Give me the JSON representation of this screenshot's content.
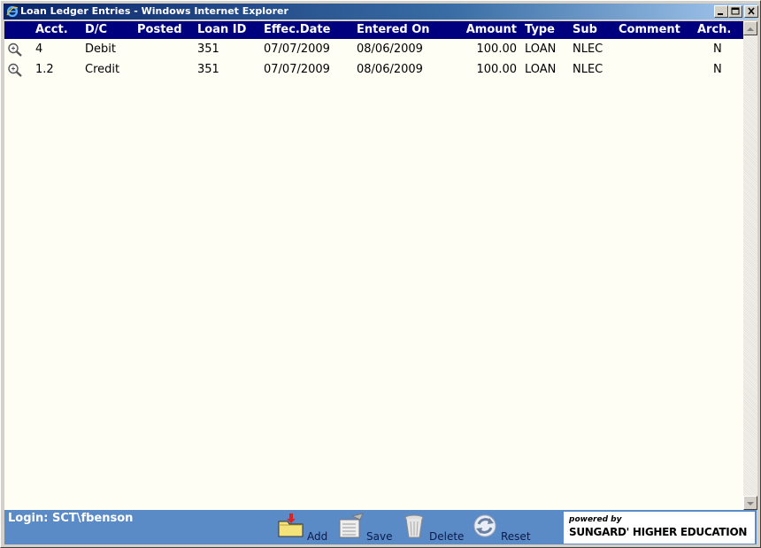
{
  "window": {
    "title": "Loan Ledger Entries - Windows Internet Explorer"
  },
  "grid": {
    "columns": [
      "Acct.",
      "D/C",
      "Posted",
      "Loan ID",
      "Effec.Date",
      "Entered On",
      "Amount",
      "Type",
      "Sub",
      "Comment",
      "Arch."
    ],
    "rows": [
      {
        "acct": "4",
        "dc": "Debit",
        "posted": "",
        "loan_id": "351",
        "effec_date": "07/07/2009",
        "entered_on": "08/06/2009",
        "amount": "100.00",
        "type": "LOAN",
        "sub": "NLEC",
        "comment": "",
        "arch": "N"
      },
      {
        "acct": "1.2",
        "dc": "Credit",
        "posted": "",
        "loan_id": "351",
        "effec_date": "07/07/2009",
        "entered_on": "08/06/2009",
        "amount": "100.00",
        "type": "LOAN",
        "sub": "NLEC",
        "comment": "",
        "arch": "N"
      }
    ]
  },
  "footer": {
    "login": "Login: SCT\\fbenson",
    "actions": {
      "add": "Add",
      "save": "Save",
      "delete": "Delete",
      "reset": "Reset"
    },
    "powered_by": "powered by",
    "brand": "SUNGARD' HIGHER EDUCATION"
  },
  "colors": {
    "header_bg": "#00007f",
    "footer_bg": "#5a8bc6",
    "content_bg": "#fefef4"
  }
}
